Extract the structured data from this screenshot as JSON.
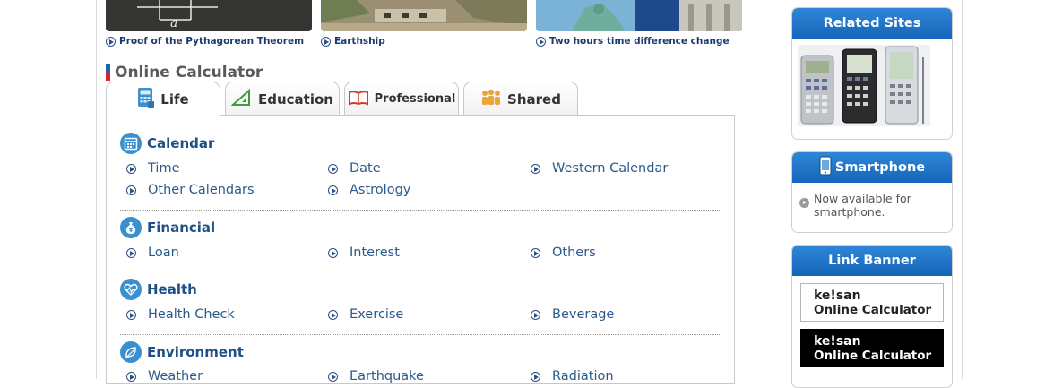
{
  "featured": [
    {
      "label": "Proof of the Pythagorean Theorem",
      "thumb_icon": "chalkboard-image"
    },
    {
      "label": "Earthship",
      "thumb_icon": "landscape-image"
    },
    {
      "label": "Two hours time difference change",
      "thumb_icon": "statue-of-liberty-image"
    }
  ],
  "section": {
    "title": "Online Calculator"
  },
  "tabs": [
    {
      "label": "Life",
      "icon": "calculator-icon",
      "active": true
    },
    {
      "label": "Education",
      "icon": "triangle-ruler-icon",
      "active": false
    },
    {
      "label": "Professional",
      "icon": "open-book-icon",
      "active": false
    },
    {
      "label": "Shared",
      "icon": "people-icon",
      "active": false
    }
  ],
  "categories": [
    {
      "title": "Calendar",
      "icon": "calendar-icon",
      "items": [
        "Time",
        "Date",
        "Western Calendar",
        "Other Calendars",
        "Astrology"
      ]
    },
    {
      "title": "Financial",
      "icon": "money-bag-icon",
      "items": [
        "Loan",
        "Interest",
        "Others"
      ]
    },
    {
      "title": "Health",
      "icon": "heart-pulse-icon",
      "items": [
        "Health Check",
        "Exercise",
        "Beverage"
      ]
    },
    {
      "title": "Environment",
      "icon": "leaf-icon",
      "items": [
        "Weather",
        "Earthquake",
        "Radiation"
      ]
    }
  ],
  "sidebar": {
    "related_sites": {
      "title": "Related Sites",
      "image": "casio-calculators-image"
    },
    "smartphone": {
      "title": "Smartphone",
      "text": "Now available for smartphone."
    },
    "link_banner": {
      "title": "Link Banner",
      "banner_line1": "ke!san",
      "banner_line2": "Online Calculator"
    }
  },
  "colors": {
    "accent_blue": "#1565b8",
    "link_blue": "#2b5a8a",
    "heading_grey": "#5a5a5a",
    "banner_red": "#d8232a"
  }
}
